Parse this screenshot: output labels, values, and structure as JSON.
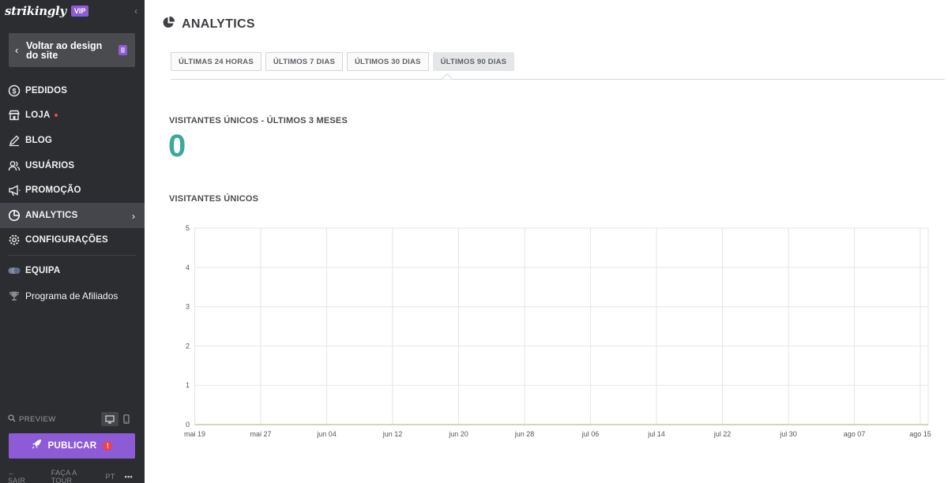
{
  "sidebar": {
    "brand": {
      "logo": "strikingly",
      "badge": "VIP"
    },
    "back_button": {
      "label": "Voltar ao design do site"
    },
    "nav": [
      {
        "label": "PEDIDOS",
        "icon": "dollar-circle-icon"
      },
      {
        "label": "LOJA",
        "icon": "store-icon",
        "dot": true
      },
      {
        "label": "BLOG",
        "icon": "pen-icon"
      },
      {
        "label": "USUÁRIOS",
        "icon": "users-icon"
      },
      {
        "label": "PROMOÇÃO",
        "icon": "megaphone-icon"
      },
      {
        "label": "ANALYTICS",
        "icon": "pie-chart-icon",
        "active": true
      },
      {
        "label": "CONFIGURAÇÕES",
        "icon": "gear-icon"
      },
      {
        "label": "EQUIPA",
        "icon": "team-avatars-icon"
      },
      {
        "label": "Programa de Afiliados",
        "icon": "trophy-icon"
      }
    ],
    "preview": {
      "label": "PREVIEW"
    },
    "publish": {
      "label": "PUBLICAR",
      "warning": "!"
    },
    "footer": {
      "exit": "SAIR",
      "tour": "FAÇA A TOUR",
      "lang": "PT"
    }
  },
  "main": {
    "title": "ANALYTICS",
    "tabs": [
      {
        "label": "ÚLTIMAS 24 HORAS",
        "selected": false
      },
      {
        "label": "ÚLTIMOS 7 DIAS",
        "selected": false
      },
      {
        "label": "ÚLTIMOS 30 DIAS",
        "selected": false
      },
      {
        "label": "ÚLTIMOS 90 DIAS",
        "selected": true
      }
    ],
    "metric": {
      "label": "VISITANTES ÚNICOS - ÚLTIMOS 3 MESES",
      "value": "0"
    },
    "chart_title": "VISITANTES ÚNICOS"
  },
  "colors": {
    "accent": "#8e5bd6",
    "metric": "#3aa99a",
    "sidebar": "#2c2d30",
    "line": "#c8c9a0"
  },
  "chart_data": {
    "type": "line",
    "categories": [
      "mai 19",
      "mai 27",
      "jun 04",
      "jun 12",
      "jun 20",
      "jun 28",
      "jul 06",
      "jul 14",
      "jul 22",
      "jul 30",
      "ago 07",
      "ago 15"
    ],
    "series": [
      {
        "values": [
          0,
          0,
          0,
          0,
          0,
          0,
          0,
          0,
          0,
          0,
          0,
          0
        ]
      }
    ],
    "yticks": [
      0,
      1,
      2,
      3,
      4,
      5
    ],
    "ylim": [
      0,
      5
    ],
    "grid": true,
    "title": "",
    "xlabel": "",
    "ylabel": ""
  }
}
